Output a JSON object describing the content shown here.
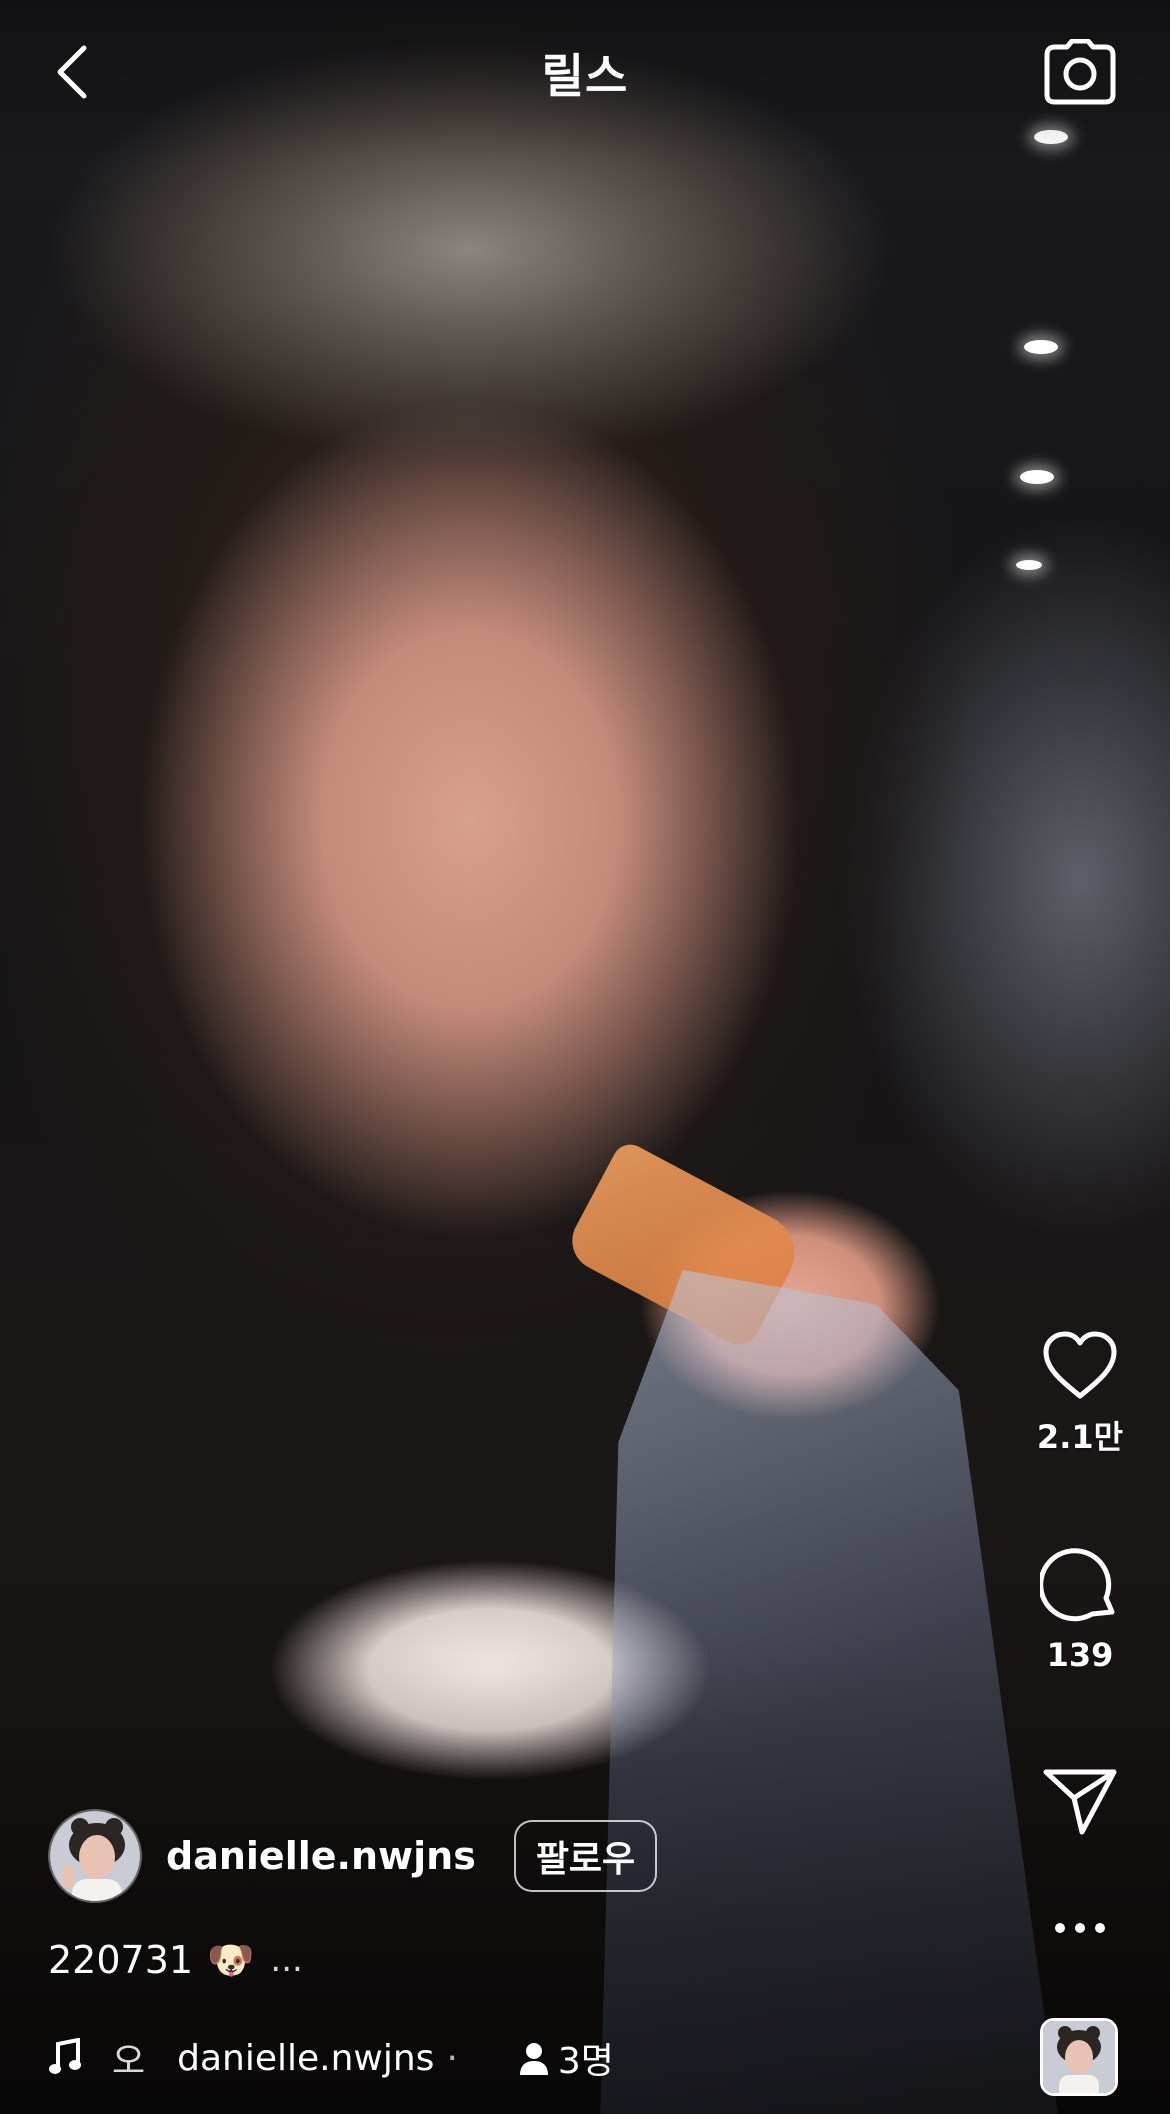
{
  "header": {
    "title": "릴스"
  },
  "actions": {
    "likes": "2.1만",
    "comments": "139"
  },
  "owner": {
    "username": "danielle.nwjns",
    "follow_label": "팔로우"
  },
  "caption": {
    "text": "220731",
    "emoji": "🐶",
    "more": "..."
  },
  "audio": {
    "prefix": "오",
    "name": "danielle.nwjns",
    "separator": "·",
    "people": "3명"
  },
  "icons": {
    "back": "chevron-left-icon",
    "camera": "camera-icon",
    "like": "heart-icon",
    "comment": "comment-bubble-icon",
    "share": "send-icon",
    "more": "ellipsis-icon",
    "audio": "music-note-icon",
    "people": "person-icon"
  }
}
